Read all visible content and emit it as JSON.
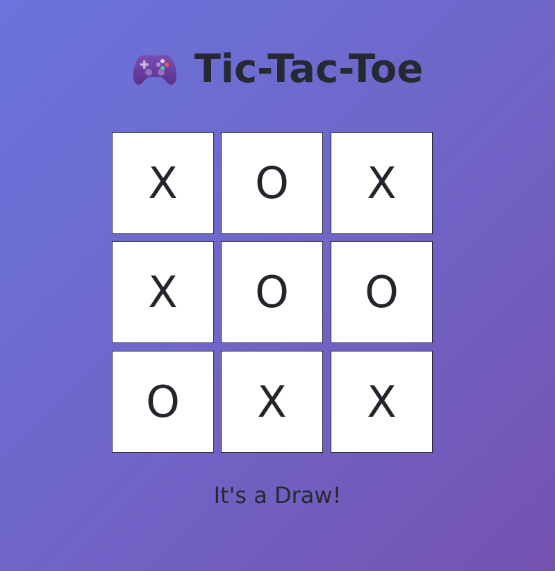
{
  "header": {
    "title": "Tic-Tac-Toe",
    "icon": "game-controller-icon"
  },
  "board": {
    "cells": [
      "X",
      "O",
      "X",
      "X",
      "O",
      "O",
      "O",
      "X",
      "X"
    ]
  },
  "status": {
    "message": "It's a Draw!"
  },
  "colors": {
    "background_start": "#6a74dc",
    "background_end": "#7552b0",
    "cell_background": "#ffffff",
    "text": "#262832"
  }
}
